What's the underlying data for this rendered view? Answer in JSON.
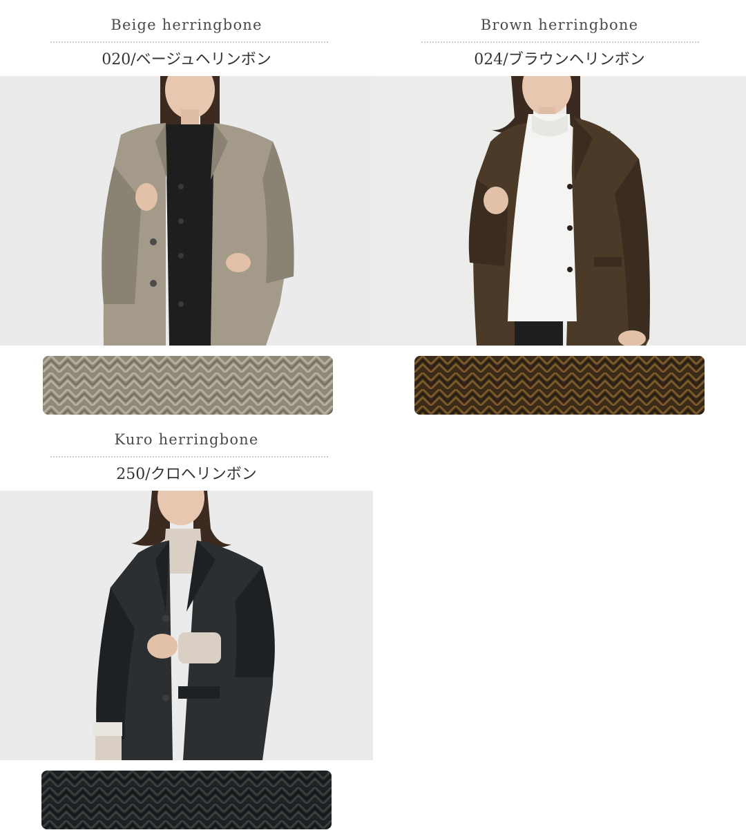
{
  "variants": [
    {
      "en_name": "Beige herringbone",
      "jp_name": "020/ベージュヘリンボン",
      "colors": {
        "coat": "#a39a89",
        "coat_dark": "#8a8272",
        "inner": "#1e1e1e",
        "swatch_base": "#8f8878",
        "swatch_light": "#b7b0a0",
        "swatch_dark": "#6b6556"
      }
    },
    {
      "en_name": "Brown herringbone",
      "jp_name": "024/ブラウンヘリンボン",
      "colors": {
        "coat": "#4c3a28",
        "coat_dark": "#3a2c1e",
        "inner": "#f4f4f2",
        "swatch_base": "#3a2a1a",
        "swatch_light": "#7a5a2a",
        "swatch_dark": "#201810"
      }
    },
    {
      "en_name": "Kuro herringbone",
      "jp_name": "250/クロヘリンボン",
      "colors": {
        "coat": "#2c2f31",
        "coat_dark": "#1e2123",
        "inner": "#d9cfc4",
        "swatch_base": "#1c2024",
        "swatch_light": "#3a403a",
        "swatch_dark": "#111417"
      }
    }
  ]
}
